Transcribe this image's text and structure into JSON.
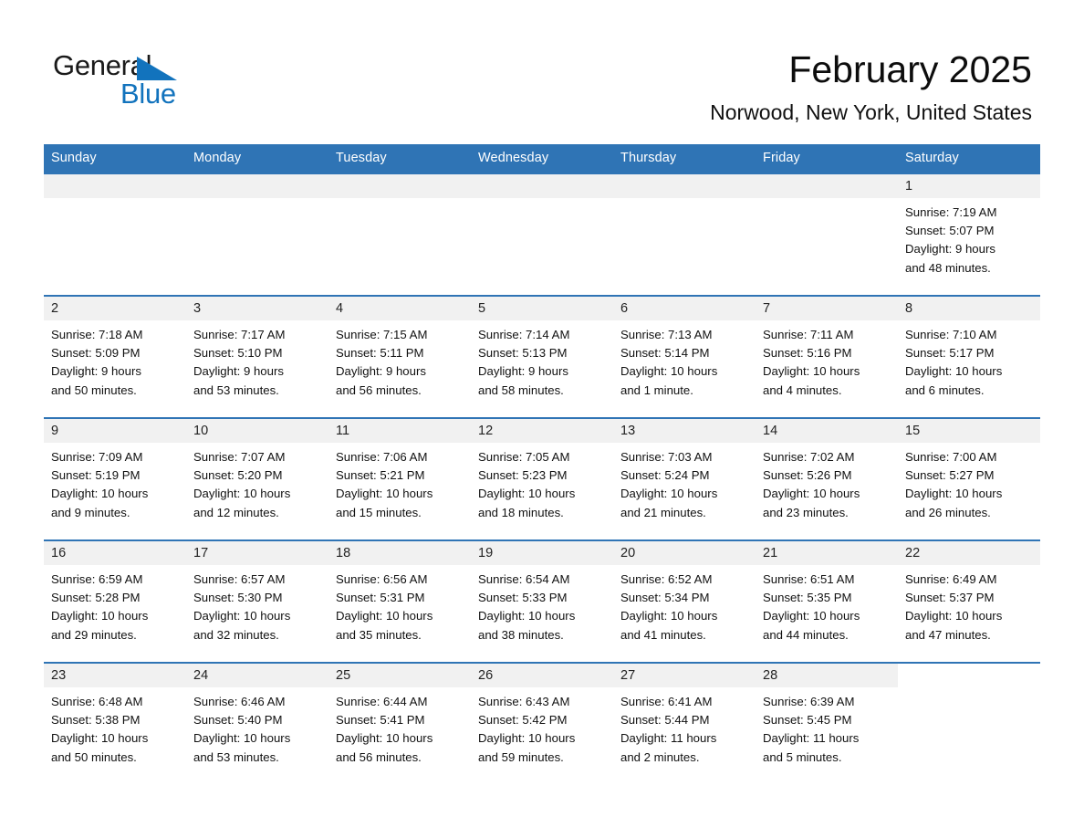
{
  "brand": {
    "name_part1": "General",
    "name_part2": "Blue",
    "logo_color": "#1273bd",
    "triangle_icon": "blue-triangle-icon"
  },
  "header": {
    "title": "February 2025",
    "location": "Norwood, New York, United States"
  },
  "theme": {
    "header_blue": "#2f74b5",
    "daynum_gray": "#f1f1f1",
    "text_dark": "#111111"
  },
  "weekdays": [
    "Sunday",
    "Monday",
    "Tuesday",
    "Wednesday",
    "Thursday",
    "Friday",
    "Saturday"
  ],
  "labels": {
    "sunrise": "Sunrise:",
    "sunset": "Sunset:",
    "daylight": "Daylight:"
  },
  "weeks": [
    [
      {
        "day": "",
        "empty": true
      },
      {
        "day": "",
        "empty": true
      },
      {
        "day": "",
        "empty": true
      },
      {
        "day": "",
        "empty": true
      },
      {
        "day": "",
        "empty": true
      },
      {
        "day": "",
        "empty": true
      },
      {
        "day": "1",
        "sunrise": "Sunrise: 7:19 AM",
        "sunset": "Sunset: 5:07 PM",
        "daylight_line1": "Daylight: 9 hours",
        "daylight_line2": "and 48 minutes."
      }
    ],
    [
      {
        "day": "2",
        "sunrise": "Sunrise: 7:18 AM",
        "sunset": "Sunset: 5:09 PM",
        "daylight_line1": "Daylight: 9 hours",
        "daylight_line2": "and 50 minutes."
      },
      {
        "day": "3",
        "sunrise": "Sunrise: 7:17 AM",
        "sunset": "Sunset: 5:10 PM",
        "daylight_line1": "Daylight: 9 hours",
        "daylight_line2": "and 53 minutes."
      },
      {
        "day": "4",
        "sunrise": "Sunrise: 7:15 AM",
        "sunset": "Sunset: 5:11 PM",
        "daylight_line1": "Daylight: 9 hours",
        "daylight_line2": "and 56 minutes."
      },
      {
        "day": "5",
        "sunrise": "Sunrise: 7:14 AM",
        "sunset": "Sunset: 5:13 PM",
        "daylight_line1": "Daylight: 9 hours",
        "daylight_line2": "and 58 minutes."
      },
      {
        "day": "6",
        "sunrise": "Sunrise: 7:13 AM",
        "sunset": "Sunset: 5:14 PM",
        "daylight_line1": "Daylight: 10 hours",
        "daylight_line2": "and 1 minute."
      },
      {
        "day": "7",
        "sunrise": "Sunrise: 7:11 AM",
        "sunset": "Sunset: 5:16 PM",
        "daylight_line1": "Daylight: 10 hours",
        "daylight_line2": "and 4 minutes."
      },
      {
        "day": "8",
        "sunrise": "Sunrise: 7:10 AM",
        "sunset": "Sunset: 5:17 PM",
        "daylight_line1": "Daylight: 10 hours",
        "daylight_line2": "and 6 minutes."
      }
    ],
    [
      {
        "day": "9",
        "sunrise": "Sunrise: 7:09 AM",
        "sunset": "Sunset: 5:19 PM",
        "daylight_line1": "Daylight: 10 hours",
        "daylight_line2": "and 9 minutes."
      },
      {
        "day": "10",
        "sunrise": "Sunrise: 7:07 AM",
        "sunset": "Sunset: 5:20 PM",
        "daylight_line1": "Daylight: 10 hours",
        "daylight_line2": "and 12 minutes."
      },
      {
        "day": "11",
        "sunrise": "Sunrise: 7:06 AM",
        "sunset": "Sunset: 5:21 PM",
        "daylight_line1": "Daylight: 10 hours",
        "daylight_line2": "and 15 minutes."
      },
      {
        "day": "12",
        "sunrise": "Sunrise: 7:05 AM",
        "sunset": "Sunset: 5:23 PM",
        "daylight_line1": "Daylight: 10 hours",
        "daylight_line2": "and 18 minutes."
      },
      {
        "day": "13",
        "sunrise": "Sunrise: 7:03 AM",
        "sunset": "Sunset: 5:24 PM",
        "daylight_line1": "Daylight: 10 hours",
        "daylight_line2": "and 21 minutes."
      },
      {
        "day": "14",
        "sunrise": "Sunrise: 7:02 AM",
        "sunset": "Sunset: 5:26 PM",
        "daylight_line1": "Daylight: 10 hours",
        "daylight_line2": "and 23 minutes."
      },
      {
        "day": "15",
        "sunrise": "Sunrise: 7:00 AM",
        "sunset": "Sunset: 5:27 PM",
        "daylight_line1": "Daylight: 10 hours",
        "daylight_line2": "and 26 minutes."
      }
    ],
    [
      {
        "day": "16",
        "sunrise": "Sunrise: 6:59 AM",
        "sunset": "Sunset: 5:28 PM",
        "daylight_line1": "Daylight: 10 hours",
        "daylight_line2": "and 29 minutes."
      },
      {
        "day": "17",
        "sunrise": "Sunrise: 6:57 AM",
        "sunset": "Sunset: 5:30 PM",
        "daylight_line1": "Daylight: 10 hours",
        "daylight_line2": "and 32 minutes."
      },
      {
        "day": "18",
        "sunrise": "Sunrise: 6:56 AM",
        "sunset": "Sunset: 5:31 PM",
        "daylight_line1": "Daylight: 10 hours",
        "daylight_line2": "and 35 minutes."
      },
      {
        "day": "19",
        "sunrise": "Sunrise: 6:54 AM",
        "sunset": "Sunset: 5:33 PM",
        "daylight_line1": "Daylight: 10 hours",
        "daylight_line2": "and 38 minutes."
      },
      {
        "day": "20",
        "sunrise": "Sunrise: 6:52 AM",
        "sunset": "Sunset: 5:34 PM",
        "daylight_line1": "Daylight: 10 hours",
        "daylight_line2": "and 41 minutes."
      },
      {
        "day": "21",
        "sunrise": "Sunrise: 6:51 AM",
        "sunset": "Sunset: 5:35 PM",
        "daylight_line1": "Daylight: 10 hours",
        "daylight_line2": "and 44 minutes."
      },
      {
        "day": "22",
        "sunrise": "Sunrise: 6:49 AM",
        "sunset": "Sunset: 5:37 PM",
        "daylight_line1": "Daylight: 10 hours",
        "daylight_line2": "and 47 minutes."
      }
    ],
    [
      {
        "day": "23",
        "sunrise": "Sunrise: 6:48 AM",
        "sunset": "Sunset: 5:38 PM",
        "daylight_line1": "Daylight: 10 hours",
        "daylight_line2": "and 50 minutes."
      },
      {
        "day": "24",
        "sunrise": "Sunrise: 6:46 AM",
        "sunset": "Sunset: 5:40 PM",
        "daylight_line1": "Daylight: 10 hours",
        "daylight_line2": "and 53 minutes."
      },
      {
        "day": "25",
        "sunrise": "Sunrise: 6:44 AM",
        "sunset": "Sunset: 5:41 PM",
        "daylight_line1": "Daylight: 10 hours",
        "daylight_line2": "and 56 minutes."
      },
      {
        "day": "26",
        "sunrise": "Sunrise: 6:43 AM",
        "sunset": "Sunset: 5:42 PM",
        "daylight_line1": "Daylight: 10 hours",
        "daylight_line2": "and 59 minutes."
      },
      {
        "day": "27",
        "sunrise": "Sunrise: 6:41 AM",
        "sunset": "Sunset: 5:44 PM",
        "daylight_line1": "Daylight: 11 hours",
        "daylight_line2": "and 2 minutes."
      },
      {
        "day": "28",
        "sunrise": "Sunrise: 6:39 AM",
        "sunset": "Sunset: 5:45 PM",
        "daylight_line1": "Daylight: 11 hours",
        "daylight_line2": "and 5 minutes."
      },
      {
        "day": "",
        "empty": true,
        "no_band": true
      }
    ]
  ]
}
